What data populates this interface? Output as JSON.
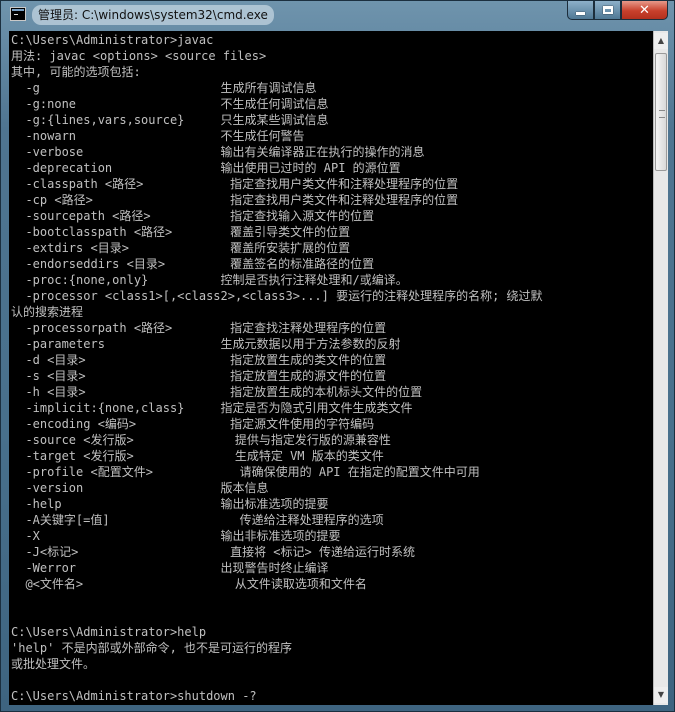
{
  "window": {
    "title": "管理员: C:\\windows\\system32\\cmd.exe",
    "controls": {
      "close": "✕"
    }
  },
  "console": {
    "lines": [
      "C:\\Users\\Administrator>javac",
      "用法: javac <options> <source files>",
      "其中, 可能的选项包括:",
      "  -g                         生成所有调试信息",
      "  -g:none                    不生成任何调试信息",
      "  -g:{lines,vars,source}     只生成某些调试信息",
      "  -nowarn                    不生成任何警告",
      "  -verbose                   输出有关编译器正在执行的操作的消息",
      "  -deprecation               输出使用已过时的 API 的源位置",
      "  -classpath <路径>            指定查找用户类文件和注释处理程序的位置",
      "  -cp <路径>                   指定查找用户类文件和注释处理程序的位置",
      "  -sourcepath <路径>           指定查找输入源文件的位置",
      "  -bootclasspath <路径>        覆盖引导类文件的位置",
      "  -extdirs <目录>              覆盖所安装扩展的位置",
      "  -endorseddirs <目录>         覆盖签名的标准路径的位置",
      "  -proc:{none,only}          控制是否执行注释处理和/或编译。",
      "  -processor <class1>[,<class2>,<class3>...] 要运行的注释处理程序的名称; 绕过默",
      "认的搜索进程",
      "  -processorpath <路径>        指定查找注释处理程序的位置",
      "  -parameters                生成元数据以用于方法参数的反射",
      "  -d <目录>                    指定放置生成的类文件的位置",
      "  -s <目录>                    指定放置生成的源文件的位置",
      "  -h <目录>                    指定放置生成的本机标头文件的位置",
      "  -implicit:{none,class}     指定是否为隐式引用文件生成类文件",
      "  -encoding <编码>             指定源文件使用的字符编码",
      "  -source <发行版>              提供与指定发行版的源兼容性",
      "  -target <发行版>              生成特定 VM 版本的类文件",
      "  -profile <配置文件>            请确保使用的 API 在指定的配置文件中可用",
      "  -version                   版本信息",
      "  -help                      输出标准选项的提要",
      "  -A关键字[=值]                  传递给注释处理程序的选项",
      "  -X                         输出非标准选项的提要",
      "  -J<标记>                     直接将 <标记> 传递给运行时系统",
      "  -Werror                    出现警告时终止编译",
      "  @<文件名>                     从文件读取选项和文件名",
      "",
      "",
      "C:\\Users\\Administrator>help",
      "'help' 不是内部或外部命令, 也不是可运行的程序",
      "或批处理文件。",
      "",
      "C:\\Users\\Administrator>shutdown -?"
    ]
  },
  "scrollbar": {
    "up_arrow": "▲",
    "down_arrow": "▼"
  }
}
